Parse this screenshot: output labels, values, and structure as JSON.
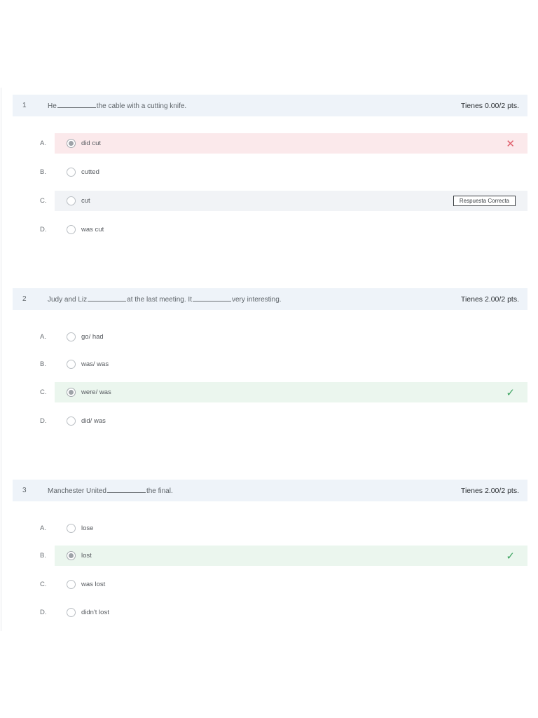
{
  "questions": [
    {
      "number": "1",
      "text_before": "He",
      "text_mid": "the cable with a cutting knife.",
      "text_after": "",
      "score": "Tienes 0.00/2 pts.",
      "options": [
        {
          "letter": "A.",
          "label": "did cut",
          "selected": true,
          "state": "wrong"
        },
        {
          "letter": "B.",
          "label": "cutted",
          "selected": false,
          "state": "none"
        },
        {
          "letter": "C.",
          "label": "cut",
          "selected": false,
          "state": "shown",
          "tag": "Respuesta Correcta"
        },
        {
          "letter": "D.",
          "label": "was cut",
          "selected": false,
          "state": "none"
        }
      ]
    },
    {
      "number": "2",
      "text_before": "Judy and Liz",
      "text_mid": "at the last meeting. It",
      "text_after": "very interesting.",
      "score": "Tienes 2.00/2 pts.",
      "options": [
        {
          "letter": "A.",
          "label": "go/ had",
          "selected": false,
          "state": "none"
        },
        {
          "letter": "B.",
          "label": "was/ was",
          "selected": false,
          "state": "none"
        },
        {
          "letter": "C.",
          "label": "were/ was",
          "selected": true,
          "state": "right"
        },
        {
          "letter": "D.",
          "label": "did/ was",
          "selected": false,
          "state": "none"
        }
      ]
    },
    {
      "number": "3",
      "text_before": "Manchester United",
      "text_mid": "the final.",
      "text_after": "",
      "score": "Tienes 2.00/2 pts.",
      "options": [
        {
          "letter": "A.",
          "label": "lose",
          "selected": false,
          "state": "none"
        },
        {
          "letter": "B.",
          "label": "lost",
          "selected": true,
          "state": "right"
        },
        {
          "letter": "C.",
          "label": "was lost",
          "selected": false,
          "state": "none"
        },
        {
          "letter": "D.",
          "label": "didn't lost",
          "selected": false,
          "state": "none"
        }
      ]
    }
  ],
  "icons": {
    "wrong": "close-icon",
    "right": "checkmark-icon"
  },
  "colors": {
    "header_bg": "#eef3f9",
    "wrong_bg": "#fbe9eb",
    "right_bg": "#ebf6ee",
    "shown_bg": "#f1f3f6",
    "wrong_mark": "#e0606c",
    "right_mark": "#3fa462"
  }
}
